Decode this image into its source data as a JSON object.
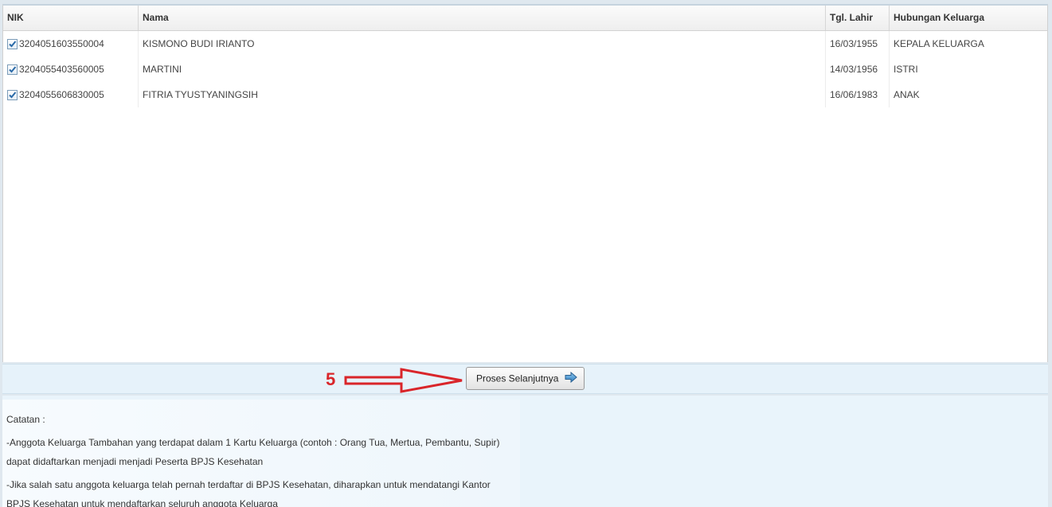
{
  "table": {
    "columns": {
      "nik": "NIK",
      "nama": "Nama",
      "tgl_lahir": "Tgl. Lahir",
      "hubungan": "Hubungan Keluarga"
    },
    "rows": [
      {
        "checked": true,
        "nik": "3204051603550004",
        "nama": "KISMONO BUDI IRIANTO",
        "tgl_lahir": "16/03/1955",
        "hubungan": "KEPALA KELUARGA"
      },
      {
        "checked": true,
        "nik": "3204055403560005",
        "nama": "MARTINI",
        "tgl_lahir": "14/03/1956",
        "hubungan": "ISTRI"
      },
      {
        "checked": true,
        "nik": "3204055606830005",
        "nama": "FITRIA TYUSTYANINGSIH",
        "tgl_lahir": "16/06/1983",
        "hubungan": "ANAK"
      }
    ]
  },
  "annotation": {
    "step_number": "5",
    "color": "#d9252a"
  },
  "actions": {
    "proceed_label": "Proses Selanjutnya",
    "proceed_icon": "arrow-right-icon"
  },
  "notes": {
    "title": "Catatan :",
    "line1": "-Anggota Keluarga Tambahan yang terdapat dalam 1 Kartu Keluarga (contoh : Orang Tua, Mertua, Pembantu, Supir)",
    "line2": "dapat didaftarkan menjadi menjadi Peserta BPJS Kesehatan",
    "line3": "-Jika salah satu anggota keluarga telah pernah terdaftar di BPJS Kesehatan, diharapkan untuk mendatangi Kantor",
    "line4": "BPJS Kesehatan untuk mendaftarkan seluruh anggota Keluarga"
  }
}
